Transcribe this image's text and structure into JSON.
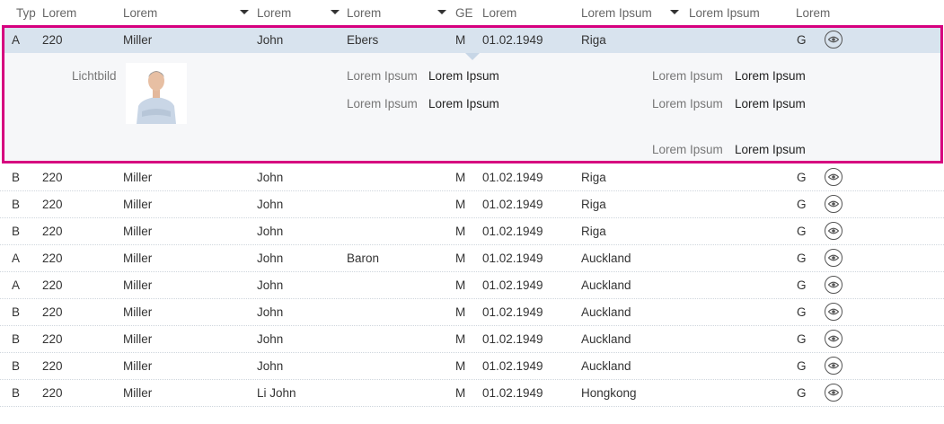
{
  "header": {
    "typ": "Typ",
    "col2": "Lorem",
    "col3": "Lorem",
    "col4": "Lorem",
    "col5": "Lorem",
    "ge": "GE",
    "col7": "Lorem",
    "col8": "Lorem Ipsum",
    "col9": "Lorem Ipsum",
    "col10": "Lorem"
  },
  "selected": {
    "typ": "A",
    "num": "220",
    "last": "Miller",
    "first": "John",
    "extra": "Ebers",
    "ge": "M",
    "date": "01.02.1949",
    "city": "Riga",
    "g": "G",
    "view_icon": "eye-icon"
  },
  "detail": {
    "photo_label": "Lichtbild",
    "fields": [
      {
        "label": "Lorem Ipsum",
        "value": "Lorem Ipsum"
      },
      {
        "label": "Lorem Ipsum",
        "value": "Lorem Ipsum"
      },
      {
        "label": "Lorem Ipsum",
        "value": "Lorem Ipsum"
      },
      {
        "label": "Lorem Ipsum",
        "value": "Lorem Ipsum"
      },
      {
        "label": "Lorem Ipsum",
        "value": "Lorem Ipsum"
      }
    ]
  },
  "rows": [
    {
      "typ": "B",
      "num": "220",
      "last": "Miller",
      "first": "John",
      "extra": "",
      "ge": "M",
      "date": "01.02.1949",
      "city": "Riga",
      "g": "G"
    },
    {
      "typ": "B",
      "num": "220",
      "last": "Miller",
      "first": "John",
      "extra": "",
      "ge": "M",
      "date": "01.02.1949",
      "city": "Riga",
      "g": "G"
    },
    {
      "typ": "B",
      "num": "220",
      "last": "Miller",
      "first": "John",
      "extra": "",
      "ge": "M",
      "date": "01.02.1949",
      "city": "Riga",
      "g": "G"
    },
    {
      "typ": "A",
      "num": "220",
      "last": "Miller",
      "first": "John",
      "extra": "Baron",
      "ge": "M",
      "date": "01.02.1949",
      "city": "Auckland",
      "g": "G"
    },
    {
      "typ": "A",
      "num": "220",
      "last": "Miller",
      "first": "John",
      "extra": "",
      "ge": "M",
      "date": "01.02.1949",
      "city": "Auckland",
      "g": "G"
    },
    {
      "typ": "B",
      "num": "220",
      "last": "Miller",
      "first": "John",
      "extra": "",
      "ge": "M",
      "date": "01.02.1949",
      "city": "Auckland",
      "g": "G"
    },
    {
      "typ": "B",
      "num": "220",
      "last": "Miller",
      "first": "John",
      "extra": "",
      "ge": "M",
      "date": "01.02.1949",
      "city": "Auckland",
      "g": "G"
    },
    {
      "typ": "B",
      "num": "220",
      "last": "Miller",
      "first": "John",
      "extra": "",
      "ge": "M",
      "date": "01.02.1949",
      "city": "Auckland",
      "g": "G"
    },
    {
      "typ": "B",
      "num": "220",
      "last": "Miller",
      "first": "Li John",
      "extra": "",
      "ge": "M",
      "date": "01.02.1949",
      "city": "Hongkong",
      "g": "G"
    }
  ],
  "colors": {
    "accent": "#d6007f",
    "selected_bg": "#d8e3ee",
    "detail_bg": "#f6f7f9"
  }
}
